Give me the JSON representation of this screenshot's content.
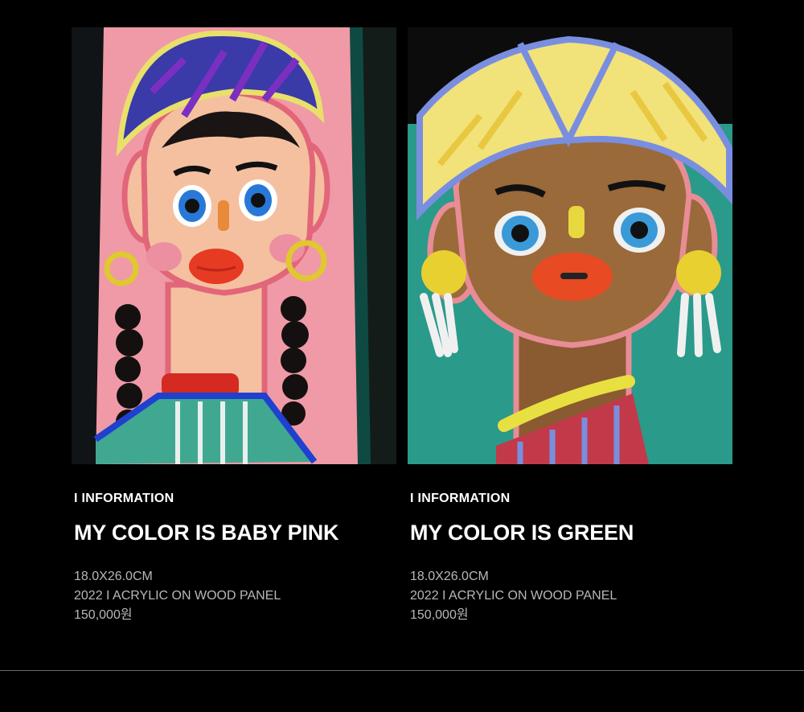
{
  "artworks": [
    {
      "section_label": "I INFORMATION",
      "title": "MY COLOR IS BABY PINK",
      "size": "18.0X26.0CM",
      "year_medium": "2022 I ACRYLIC ON WOOD PANEL",
      "price": "150,000원"
    },
    {
      "section_label": "I INFORMATION",
      "title": "MY COLOR IS GREEN",
      "size": "18.0X26.0CM",
      "year_medium": "2022 I ACRYLIC ON WOOD PANEL",
      "price": "150,000원"
    }
  ],
  "colors": {
    "background": "#000000",
    "text_primary": "#ffffff",
    "text_secondary": "#b8b8b8",
    "divider": "#6a6a6a"
  }
}
